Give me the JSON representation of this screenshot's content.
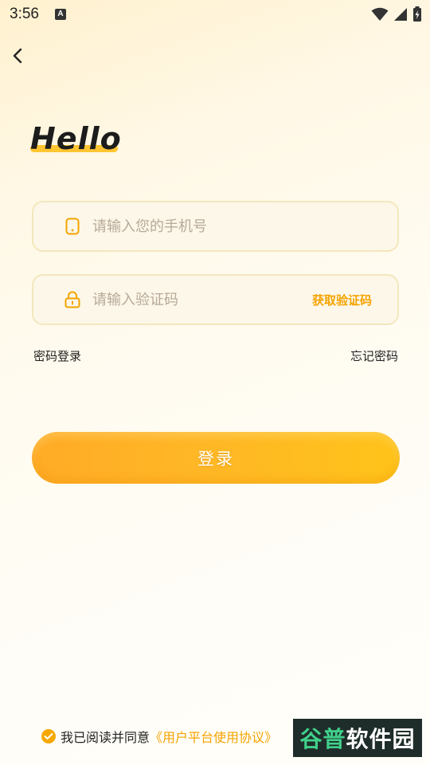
{
  "status_bar": {
    "time": "3:56",
    "notification_glyph": "A"
  },
  "page": {
    "greeting": "Hello"
  },
  "form": {
    "phone_placeholder": "请输入您的手机号",
    "code_placeholder": "请输入验证码",
    "get_code_label": "获取验证码",
    "password_login_label": "密码登录",
    "forgot_password_label": "忘记密码",
    "login_button_label": "登录"
  },
  "agreement": {
    "prefix": "我已阅读并同意",
    "link": "《用户平台使用协议》"
  },
  "watermark": {
    "first": "谷普",
    "rest": "软件园"
  },
  "colors": {
    "accent": "#f5a300",
    "button": "#ffb726",
    "field_bg": "#fcf7e8",
    "field_border": "#f4e7bd"
  },
  "icons": {
    "phone": "phone-icon",
    "lock": "lock-icon",
    "back": "chevron-left-icon",
    "check": "check-circle-icon"
  }
}
